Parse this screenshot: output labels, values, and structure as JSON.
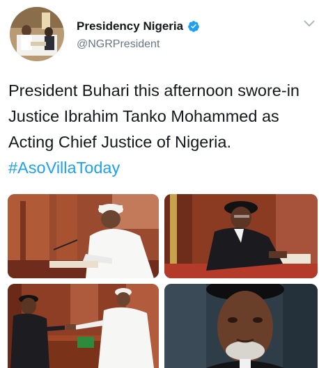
{
  "account": {
    "display_name": "Presidency Nigeria",
    "handle": "@NGRPresident",
    "verified": true
  },
  "tweet": {
    "text": "President Buhari this afternoon swore-in Justice Ibrahim Tanko Mohammed as Acting Chief Justice of Nigeria.",
    "hashtag": "#AsoVillaToday"
  },
  "icons": {
    "verified": "verified-badge-icon",
    "menu": "chevron-down-icon"
  },
  "colors": {
    "link": "#1da1f2",
    "secondary_text": "#657786",
    "primary_text": "#14171a"
  },
  "media": [
    {
      "name": "photo-president-signing"
    },
    {
      "name": "photo-justice-signing"
    },
    {
      "name": "photo-handshake"
    },
    {
      "name": "photo-justice-portrait"
    }
  ]
}
